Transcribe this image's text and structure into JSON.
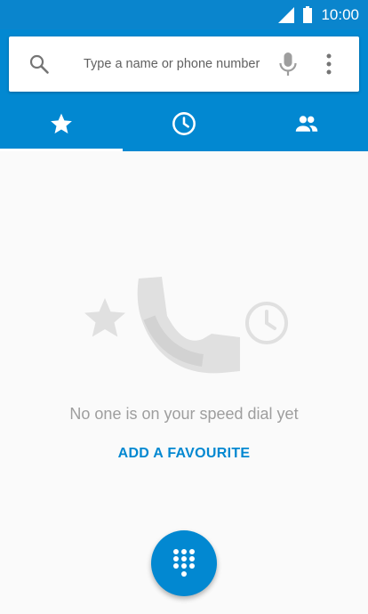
{
  "status_bar": {
    "time": "10:00",
    "signal_icon": "signal-icon",
    "battery_icon": "battery-icon"
  },
  "search": {
    "placeholder": "Type a name or phone number",
    "value": "",
    "search_icon": "search-icon",
    "mic_icon": "mic-icon",
    "more_icon": "more-vert-icon"
  },
  "tabs": [
    {
      "name": "speed-dial",
      "icon": "star-icon",
      "selected": true
    },
    {
      "name": "recents",
      "icon": "clock-icon",
      "selected": false
    },
    {
      "name": "contacts",
      "icon": "people-icon",
      "selected": false
    }
  ],
  "empty_state": {
    "message": "No one is on your speed dial yet",
    "action_label": "ADD A FAVOURITE",
    "illustration_icons": [
      "star-icon",
      "phone-handset-icon",
      "clock-icon"
    ]
  },
  "fab": {
    "icon": "dialpad-icon"
  },
  "colors": {
    "primary": "#0288d1",
    "status_bar": "#0a85cd",
    "background": "#fafafa",
    "muted_text": "#9e9e9e",
    "illustration": "#e0e0e0"
  }
}
